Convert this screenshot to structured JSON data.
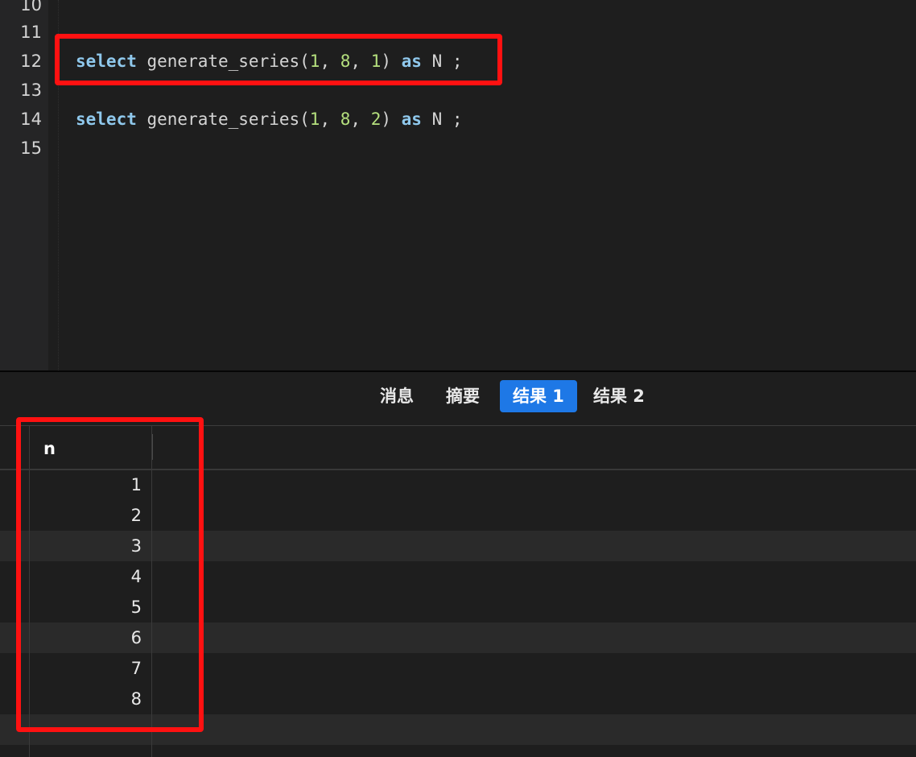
{
  "editor": {
    "lines": [
      {
        "num": "10",
        "tokens": []
      },
      {
        "num": "11",
        "tokens": []
      },
      {
        "num": "12",
        "tokens": [
          {
            "t": "kw",
            "v": "select"
          },
          {
            "t": "txt",
            "v": " generate_series("
          },
          {
            "t": "num",
            "v": "1"
          },
          {
            "t": "txt",
            "v": ", "
          },
          {
            "t": "num",
            "v": "8"
          },
          {
            "t": "txt",
            "v": ", "
          },
          {
            "t": "num",
            "v": "1"
          },
          {
            "t": "txt",
            "v": ") "
          },
          {
            "t": "kw",
            "v": "as"
          },
          {
            "t": "txt",
            "v": " N ;"
          }
        ]
      },
      {
        "num": "13",
        "tokens": []
      },
      {
        "num": "14",
        "tokens": [
          {
            "t": "kw",
            "v": "select"
          },
          {
            "t": "txt",
            "v": " generate_series("
          },
          {
            "t": "num",
            "v": "1"
          },
          {
            "t": "txt",
            "v": ", "
          },
          {
            "t": "num",
            "v": "8"
          },
          {
            "t": "txt",
            "v": ", "
          },
          {
            "t": "num",
            "v": "2"
          },
          {
            "t": "txt",
            "v": ") "
          },
          {
            "t": "kw",
            "v": "as"
          },
          {
            "t": "txt",
            "v": " N ;"
          }
        ]
      },
      {
        "num": "15",
        "tokens": []
      }
    ]
  },
  "tabs": [
    {
      "label": "消息",
      "active": false
    },
    {
      "label": "摘要",
      "active": false
    },
    {
      "label": "结果 1",
      "active": true
    },
    {
      "label": "结果 2",
      "active": false
    }
  ],
  "result": {
    "column": "n",
    "rows": [
      "1",
      "2",
      "3",
      "4",
      "5",
      "6",
      "7",
      "8"
    ]
  },
  "colors": {
    "keyword": "#8fc8ec",
    "number": "#b5e07e",
    "highlight": "#ff1111",
    "active_tab": "#1e78e6"
  }
}
